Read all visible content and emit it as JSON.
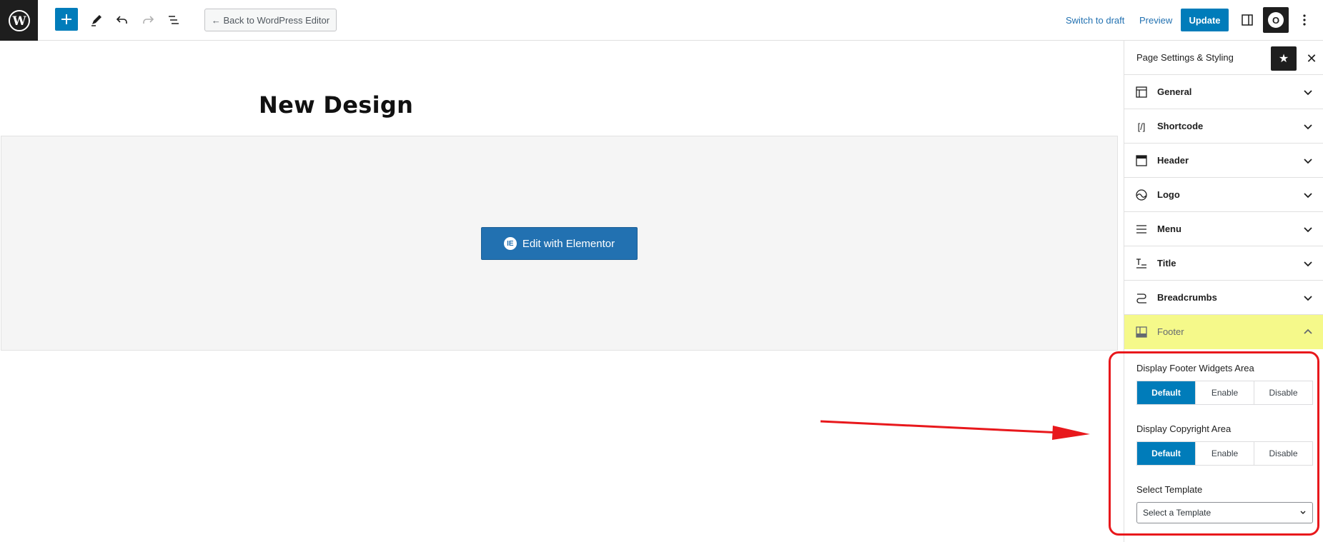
{
  "toolbar": {
    "back_label": "← Back to WordPress Editor",
    "switch_draft": "Switch to draft",
    "preview": "Preview",
    "update": "Update",
    "avatar_letter": "O"
  },
  "page": {
    "title": "New Design",
    "edit_button": "Edit with Elementor"
  },
  "sidebar": {
    "title": "Page Settings & Styling",
    "panels": [
      {
        "label": "General",
        "icon": "layout-icon"
      },
      {
        "label": "Shortcode",
        "icon": "shortcode-icon"
      },
      {
        "label": "Header",
        "icon": "header-layout-icon"
      },
      {
        "label": "Logo",
        "icon": "logo-icon"
      },
      {
        "label": "Menu",
        "icon": "menu-icon"
      },
      {
        "label": "Title",
        "icon": "title-icon"
      },
      {
        "label": "Breadcrumbs",
        "icon": "breadcrumbs-icon"
      },
      {
        "label": "Footer",
        "icon": "footer-icon"
      }
    ],
    "footer": {
      "widgets_label": "Display Footer Widgets Area",
      "widgets_options": [
        "Default",
        "Enable",
        "Disable"
      ],
      "copyright_label": "Display Copyright Area",
      "copyright_options": [
        "Default",
        "Enable",
        "Disable"
      ],
      "template_label": "Select Template",
      "template_value": "Select a Template"
    }
  },
  "colors": {
    "accent": "#007cba",
    "highlight": "#f5f98a",
    "annotation": "#e8181c"
  }
}
